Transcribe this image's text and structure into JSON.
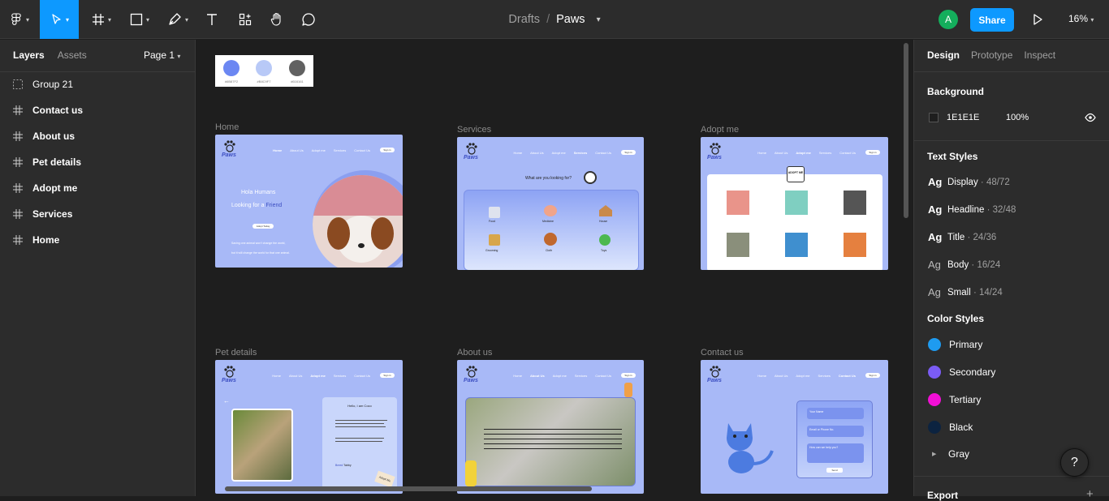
{
  "toolbar": {
    "tools": [
      "main-menu",
      "move",
      "frame",
      "shape",
      "pen",
      "text",
      "resources",
      "hand",
      "comment"
    ],
    "breadcrumb_root": "Drafts",
    "breadcrumb_sep": "/",
    "file_name": "Paws",
    "avatar_initial": "A",
    "share_label": "Share",
    "zoom": "16%",
    "accent": "#0d99ff"
  },
  "layers_panel": {
    "tab_layers": "Layers",
    "tab_assets": "Assets",
    "page": "Page 1",
    "items": [
      {
        "label": "Group 21",
        "icon": "group-icon"
      },
      {
        "label": "Contact us",
        "icon": "frame-icon"
      },
      {
        "label": "About us",
        "icon": "frame-icon"
      },
      {
        "label": "Pet details",
        "icon": "frame-icon"
      },
      {
        "label": "Adopt me",
        "icon": "frame-icon"
      },
      {
        "label": "Services",
        "icon": "frame-icon"
      },
      {
        "label": "Home",
        "icon": "frame-icon"
      }
    ]
  },
  "canvas": {
    "palette": [
      {
        "color": "#6b87f2",
        "label": "#6B87F2"
      },
      {
        "color": "#b8c9f7",
        "label": "#B8C9F7"
      },
      {
        "color": "#616161",
        "label": "#616161"
      }
    ],
    "frames": {
      "home": {
        "label": "Home",
        "heading": "Hola Humans",
        "subheading": "Looking for a",
        "highlight": "Friend",
        "cta": "Adopt Today",
        "line1": "Saving one animal won't change the world,",
        "line2": "but it will change the world for that one animal."
      },
      "services": {
        "label": "Services",
        "question": "What are you looking for?",
        "items": [
          "Food",
          "Medicine",
          "House",
          "Grooming",
          "Cloth",
          "Toys"
        ]
      },
      "adopt": {
        "label": "Adopt me",
        "badge": "ADOPT ME"
      },
      "pet": {
        "label": "Pet details",
        "title": "Hello, I am Coco",
        "breed_label": "Breed",
        "breed_value": "Tabby",
        "tag": "Adopt Me"
      },
      "about": {
        "label": "About us"
      },
      "contact": {
        "label": "Contact us",
        "field1": "Your Name",
        "field2": "Email or Phone No.",
        "field3": "How can we help you?",
        "send": "Send"
      }
    },
    "nav": {
      "home": "Home",
      "about": "About Us",
      "adopt": "Adopt me",
      "services": "Services",
      "contact": "Contact Us",
      "signin": "Sign in"
    },
    "brand": "Paws"
  },
  "design_panel": {
    "tab_design": "Design",
    "tab_prototype": "Prototype",
    "tab_inspect": "Inspect",
    "background_title": "Background",
    "background_hex": "1E1E1E",
    "background_opacity": "100%",
    "text_styles_title": "Text Styles",
    "text_styles": [
      {
        "ag": "Ag",
        "name": "Display",
        "size": " · 48/72"
      },
      {
        "ag": "Ag",
        "name": "Headline",
        "size": " · 32/48"
      },
      {
        "ag": "Ag",
        "name": "Title",
        "size": " · 24/36"
      },
      {
        "ag": "Ag",
        "name": "Body",
        "size": " · 16/24"
      },
      {
        "ag": "Ag",
        "name": "Small",
        "size": " · 14/24"
      }
    ],
    "color_styles_title": "Color Styles",
    "color_styles": [
      {
        "name": "Primary",
        "color": "#1e9bf0"
      },
      {
        "name": "Secondary",
        "color": "#7b5cf5"
      },
      {
        "name": "Tertiary",
        "color": "#f20fd6"
      },
      {
        "name": "Black",
        "color": "#0c2340"
      },
      {
        "name": "Gray",
        "color": ""
      }
    ],
    "export_title": "Export",
    "help": "?"
  }
}
